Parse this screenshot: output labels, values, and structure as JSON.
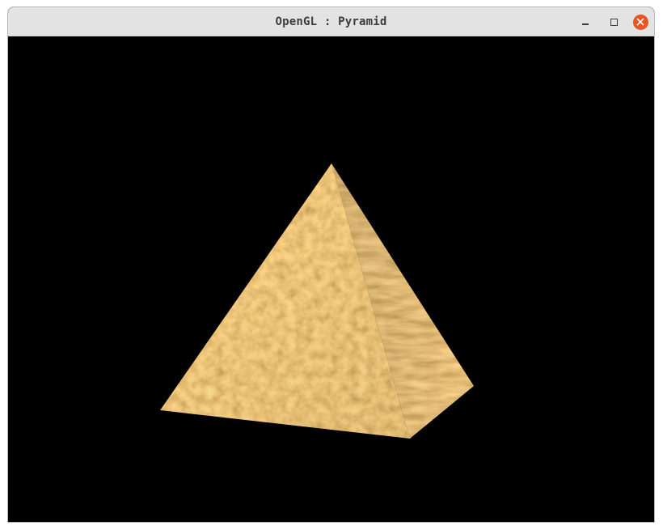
{
  "window": {
    "title": "OpenGL : Pyramid",
    "controls": {
      "minimize_icon": "minimize-icon",
      "maximize_icon": "maximize-icon",
      "close_icon": "close-icon",
      "close_color": "#e95420"
    }
  },
  "viewport": {
    "background": "#000000",
    "object": "textured-pyramid",
    "texture_colors": [
      "#c98a45",
      "#e0a860",
      "#8f5a28",
      "#f0c58a",
      "#a86e34"
    ]
  }
}
